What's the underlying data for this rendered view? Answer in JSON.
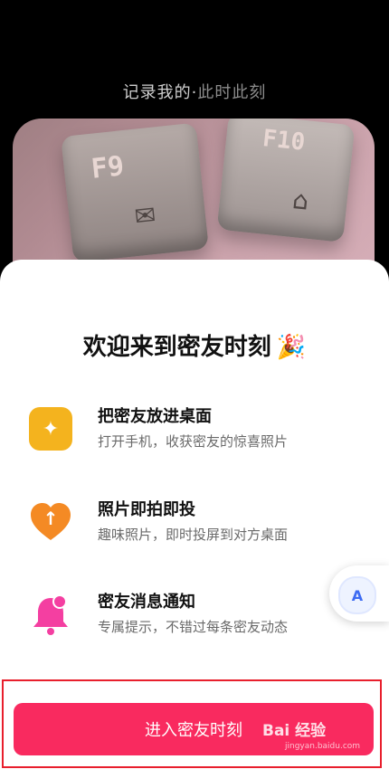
{
  "top_caption": {
    "part1": "记录我的·",
    "part2": "此时此刻"
  },
  "photo": {
    "key1_label": "F9",
    "key2_label": "F10",
    "key1_icon": "envelope-icon",
    "key2_icon": "home-icon"
  },
  "sheet": {
    "title": "欢迎来到密友时刻",
    "title_icon": "🎉"
  },
  "features": [
    {
      "icon": "sparkle-icon",
      "color": "#f4b31e",
      "title": "把密友放进桌面",
      "subtitle": "打开手机，收获密友的惊喜照片"
    },
    {
      "icon": "heart-arrow-icon",
      "color": "#f48a24",
      "title": "照片即拍即投",
      "subtitle": "趣味照片，即时投屏到对方桌面"
    },
    {
      "icon": "bell-icon",
      "color": "#f43fa1",
      "title": "密友消息通知",
      "subtitle": "专属提示，不错过每条密友动态"
    }
  ],
  "floating_button": {
    "label": "A"
  },
  "primary_button": {
    "label": "进入密友时刻"
  },
  "watermark": {
    "text": "Bai 经验",
    "sub": "jingyan.baidu.com"
  }
}
